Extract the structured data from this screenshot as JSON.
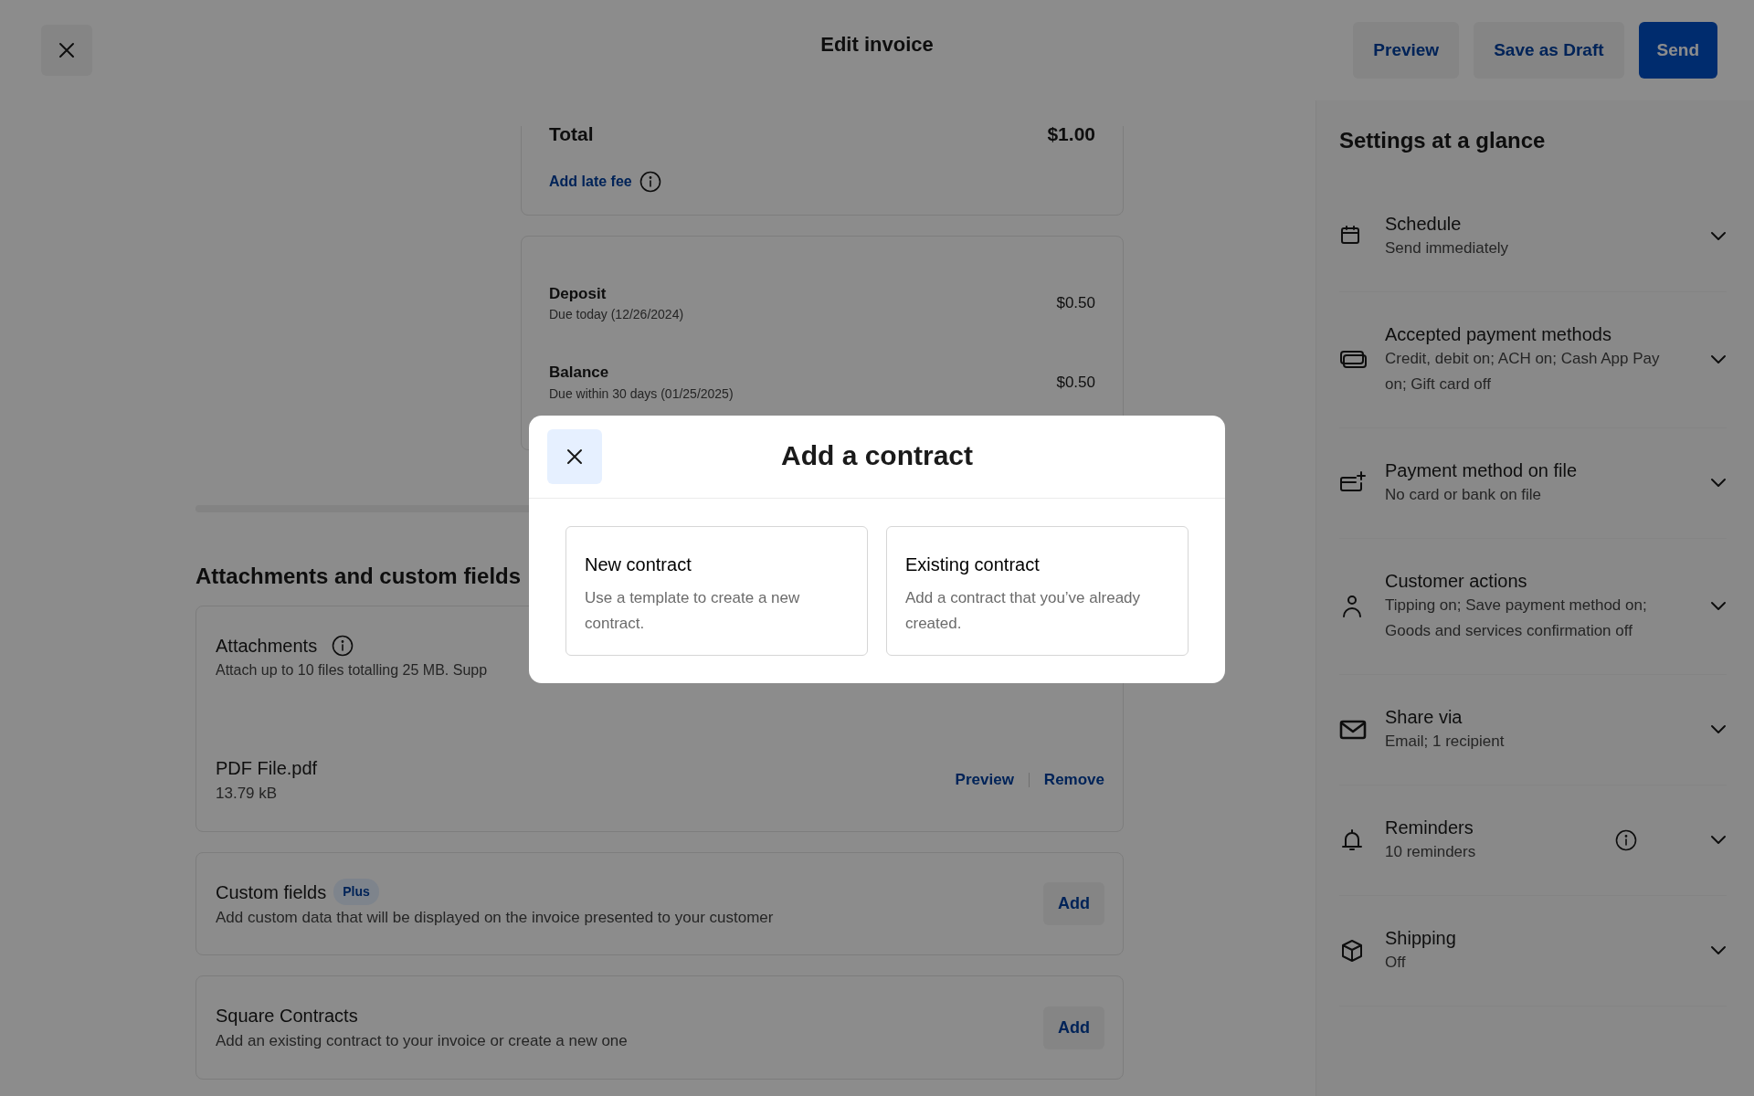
{
  "header": {
    "title": "Edit invoice",
    "buttons": [
      {
        "label": "Preview",
        "kind": "secondary"
      },
      {
        "label": "Save as Draft",
        "kind": "secondary"
      },
      {
        "label": "Send",
        "kind": "primary"
      }
    ]
  },
  "summary": {
    "total_label": "Total",
    "total_value": "$1.00",
    "late_fee_link": "Add late fee"
  },
  "payments": [
    {
      "label": "Deposit",
      "due": "Due today (12/26/2024)",
      "amount": "$0.50"
    },
    {
      "label": "Balance",
      "due": "Due within 30 days (01/25/2025)",
      "amount": "$0.50"
    }
  ],
  "attachments_section": {
    "title": "Attachments and custom fields",
    "attachments": {
      "title": "Attachments",
      "description": "Attach up to 10 files totalling 25 MB. Supp",
      "files": [
        {
          "name": "PDF File.pdf",
          "size": "13.79 kB",
          "actions": [
            "Preview",
            "Remove"
          ]
        }
      ]
    },
    "blocks": [
      {
        "title": "Custom fields",
        "badge": "Plus",
        "description": "Add custom data that will be displayed on the invoice presented to your customer",
        "action": "Add"
      },
      {
        "title": "Square Contracts",
        "description": "Add an existing contract to your invoice or create a new one",
        "action": "Add"
      }
    ]
  },
  "sidebar": {
    "title": "Settings at a glance",
    "items": [
      {
        "title": "Schedule",
        "description": "Send immediately",
        "info": false
      },
      {
        "title": "Accepted payment methods",
        "description": "Credit, debit on; ACH on; Cash App Pay on; Gift card off",
        "info": false
      },
      {
        "title": "Payment method on file",
        "description": "No card or bank on file",
        "info": false
      },
      {
        "title": "Customer actions",
        "description": "Tipping on; Save payment method on; Goods and services confirmation off",
        "info": false
      },
      {
        "title": "Share via",
        "description": "Email; 1 recipient",
        "info": false
      },
      {
        "title": "Reminders",
        "description": "10 reminders",
        "info": true
      },
      {
        "title": "Shipping",
        "description": "Off",
        "info": false
      }
    ]
  },
  "modal": {
    "title": "Add a contract",
    "options": [
      {
        "title": "New contract",
        "description": "Use a template to create a new contract."
      },
      {
        "title": "Existing contract",
        "description": "Add a contract that you’ve already created."
      }
    ]
  }
}
